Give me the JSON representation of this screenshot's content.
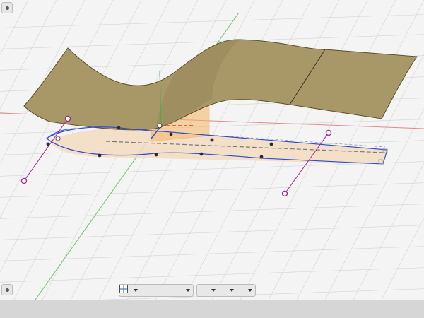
{
  "viewport": {
    "background": "#f4f4f4",
    "grid_color": "#d2d2d2",
    "axis_colors": {
      "x": "#d9534f",
      "y": "#4caf50",
      "z": "#2f54e0"
    }
  },
  "colors": {
    "surface": "#a89767",
    "surface_edge": "#5a4f2c",
    "plane_orange": "#f5b660",
    "sketch_curve": "#2e4bd6",
    "handle": "#a0288f",
    "ground_shadow": "#f3d8b8"
  },
  "icons": {
    "corner_top": "viewcube-dot-icon",
    "corner_bottom": "viewcube-dot-icon",
    "nav": [
      "orbit-icon",
      "look-at-icon",
      "pan-hand-icon",
      "zoom-icon",
      "zoom-window-icon",
      "display-settings-icon",
      "visual-style-icon",
      "grid-settings-icon"
    ]
  }
}
